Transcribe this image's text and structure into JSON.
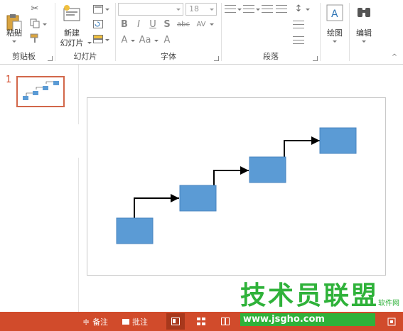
{
  "ribbon": {
    "clipboard": {
      "label": "剪贴板",
      "paste": "粘贴"
    },
    "slides": {
      "label": "幻灯片",
      "new_slide_line1": "新建",
      "new_slide_line2": "幻灯片"
    },
    "font": {
      "label": "字体",
      "font_name": "",
      "font_size": "18",
      "bold": "B",
      "italic": "I",
      "underline": "U",
      "shadow": "S",
      "strike": "abc",
      "spacing": "AV",
      "grow": "A",
      "case": "Aa",
      "clear": "A"
    },
    "paragraph": {
      "label": "段落"
    },
    "drawing": {
      "label": "绘图"
    },
    "editing": {
      "label": "编辑"
    }
  },
  "slide_panel": {
    "slide_number": "1"
  },
  "statusbar": {
    "notes_label": "备注",
    "comments_label": "批注"
  },
  "diagram": {
    "box_fill": "#5b9bd5",
    "connector_color": "#000000",
    "boxes": 4,
    "connectors": 3
  },
  "watermark": {
    "title": "技术员联盟",
    "url": "www.jsgho.com",
    "small": "软件网"
  },
  "colors": {
    "statusbar": "#d14b2b",
    "thumb_border": "#d2674a",
    "box": "#5b9bd5",
    "watermark": "#2fb23a"
  }
}
